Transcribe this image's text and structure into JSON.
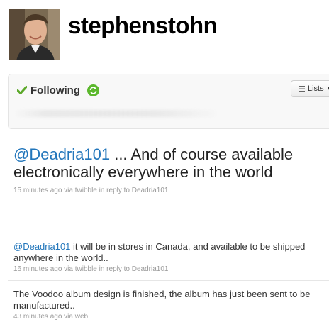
{
  "profile": {
    "username": "stephenstohn"
  },
  "follow": {
    "status_label": "Following",
    "lists_label": "Lists"
  },
  "featured_tweet": {
    "mention": "@Deadria101",
    "text": " ... And of course available electronically everywhere in the world",
    "meta": "15 minutes ago via twibble in reply to Deadria101"
  },
  "timeline": [
    {
      "mention": "@Deadria101",
      "text": " it will be in stores in Canada, and available to be shipped anywhere in the world..",
      "meta": "16 minutes ago via twibble in reply to Deadria101"
    },
    {
      "mention": "",
      "text": "The Voodoo album design is finished, the album has just been sent to be manufactured..",
      "meta": "43 minutes ago via web"
    }
  ],
  "colors": {
    "link": "#2276bb",
    "check": "#5ba829",
    "refresh": "#5cb82d",
    "meta": "#999999"
  },
  "icons": {
    "check": "check-icon",
    "refresh": "refresh-icon",
    "lists": "list-icon",
    "caret": "caret-down-icon"
  }
}
